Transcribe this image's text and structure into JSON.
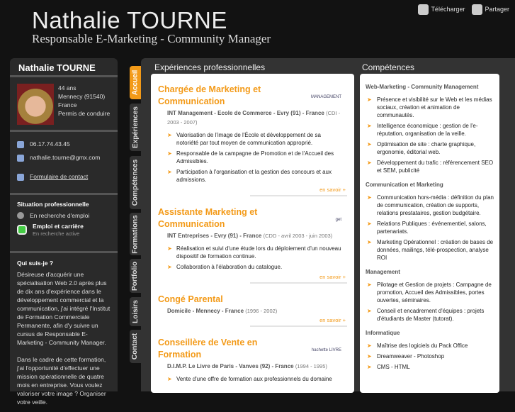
{
  "header": {
    "title": "Nathalie TOURNE",
    "subtitle": "Responsable E-Marketing - Community Manager",
    "download": "Télécharger",
    "share": "Partager"
  },
  "sidebar": {
    "name": "Nathalie TOURNE",
    "profile": [
      "44 ans",
      "Mennecy (91540)",
      "France",
      "Permis de conduire"
    ],
    "phone": "06.17.74.43.45",
    "email": "nathalie.tourne@gmx.com",
    "contact_form": "Formulaire de contact",
    "situation_title": "Situation professionnelle",
    "situation": "En recherche d'emploi",
    "career_title": "Emploi et carrière",
    "career_status": "En recherche active",
    "about_title": "Qui suis-je ?",
    "about_p1": "Désireuse d'acquérir une spécialisation Web 2.0 après plus de dix ans d'expérience dans le développement commercial et la communication, j'ai intégré l'Institut de Formation Commerciale Permanente, afin d'y suivre un cursus de Responsable E-Marketing - Community Manager.",
    "about_p2": "Dans le cadre de cette formation, j'ai l'opportunité d'effectuer une mission opérationnelle de quatre mois en entreprise. Vous voulez valoriser votre image ? Organiser votre veille."
  },
  "tabs": [
    "Accueil",
    "Expériences",
    "Compétences",
    "Formations",
    "Portfolio",
    "Loisirs",
    "Contact"
  ],
  "experiences": {
    "title": "Expériences professionnelles",
    "more": "en savoir +",
    "jobs": [
      {
        "title": "Chargée de Marketing et Communication",
        "company": "INT Management - Ecole de Commerce - Evry (91) - France",
        "period": "(CDI - 2003 - 2007)",
        "logo": "MANAGEMENT",
        "items": [
          "Valorisation de l'image de l'École et développement de sa notoriété par tout moyen de communication approprié.",
          "Responsable de la campagne de Promotion et de l'Accueil des Admissibles.",
          "Participation à l'organisation et la gestion des concours et aux admissions."
        ]
      },
      {
        "title": "Assistante Marketing et Communication",
        "company": "INT Entreprises - Evry (91) - France",
        "period": "(CDD - avril 2003 - juin 2003)",
        "logo": "get",
        "items": [
          "Réalisation et suivi d'une étude lors du déploiement d'un nouveau dispositif de formation continue.",
          "Collaboration à l'élaboration du catalogue."
        ]
      },
      {
        "title": "Congé Parental",
        "company": "Domicile - Mennecy - France",
        "period": "(1996 - 2002)",
        "items": []
      },
      {
        "title": "Conseillère de Vente en Formation",
        "company": "D.I.M.P. Le Livre de Paris - Vanves (92) - France",
        "period": "(1994 - 1995)",
        "logo": "hachette LIVRE",
        "items": [
          "Vente d'une offre de formation aux professionnels du domaine"
        ]
      }
    ]
  },
  "skills": {
    "title": "Compétences",
    "groups": [
      {
        "name": "Web-Marketing - Community Management",
        "items": [
          "Présence et visibilité sur le Web et les médias sociaux, création et animation de communautés.",
          "Intelligence économique : gestion de l'e-réputation, organisation de la veille.",
          "Optimisation de site : charte graphique, ergonomie, éditorial web.",
          "Développement du trafic : référencement SEO et SEM, publicité"
        ]
      },
      {
        "name": "Communication et Marketing",
        "items": [
          "Communication hors-média : définition du plan de communication, création de supports, relations prestataires, gestion budgétaire.",
          "Relations Publiques : événementiel, salons, partenariats.",
          "Marketing Opérationnel : création de bases de données, mailings, télé-prospection, analyse ROI"
        ]
      },
      {
        "name": "Management",
        "items": [
          "Pilotage et Gestion de projets : Campagne de promotion, Accueil des Admissibles, portes ouvertes, séminaires.",
          "Conseil et encadrement d'équipes : projets d'étudiants de Master (tutorat)."
        ]
      },
      {
        "name": "Informatique",
        "items": [
          "Maîtrise des logiciels du Pack Office",
          "Dreamweaver - Photoshop",
          "CMS - HTML"
        ]
      }
    ]
  }
}
